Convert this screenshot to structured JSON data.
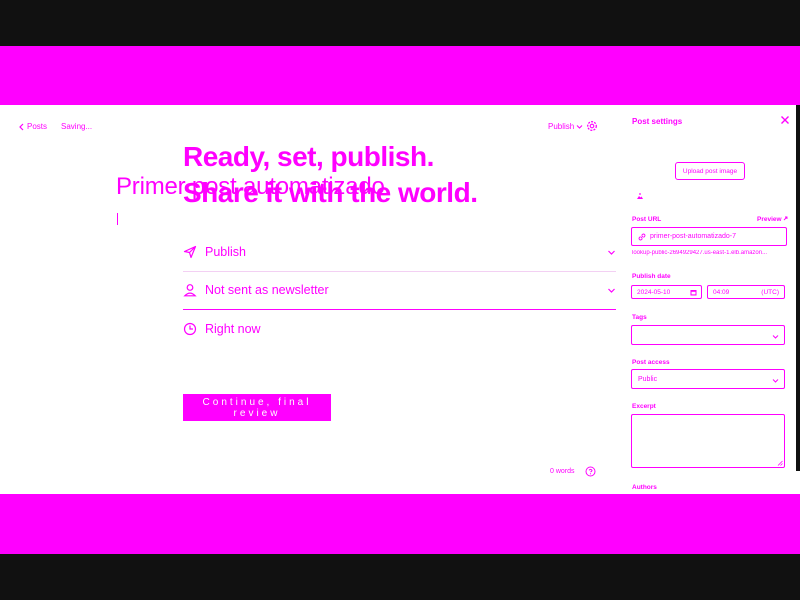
{
  "nav": {
    "back_label": "Posts",
    "status": "Saving...",
    "publish_menu_label": "Publish"
  },
  "editor": {
    "post_title": "Primer post automatizado"
  },
  "publish_flow": {
    "heading_line1": "Ready, set, publish.",
    "heading_line2": "Share it with the world.",
    "rows": [
      {
        "icon": "paper-plane-icon",
        "label": "Publish"
      },
      {
        "icon": "user-icon",
        "label": "Not sent as newsletter"
      },
      {
        "icon": "clock-icon",
        "label": "Right now"
      }
    ],
    "confirm_label": "Continue, final review"
  },
  "footer": {
    "word_count": "0 words"
  },
  "sidebar": {
    "title": "Post settings",
    "upload_button": "Upload post image",
    "post_url_label": "Post URL",
    "preview_label": "Preview",
    "post_url_value": "primer-post-automatizado-7",
    "post_url_full": "lookup-public-2694929427.us-east-1.elb.amazon...",
    "publish_date_label": "Publish date",
    "date_value": "2024-05-10",
    "time_value": "04:09",
    "timezone": "UTC",
    "tags_label": "Tags",
    "tags_value": "",
    "post_access_label": "Post access",
    "post_access_value": "Public",
    "excerpt_label": "Excerpt",
    "excerpt_value": "",
    "authors_label": "Authors"
  },
  "colors": {
    "accent": "#ff00ff",
    "background": "#ffffff",
    "frame": "#111111"
  }
}
